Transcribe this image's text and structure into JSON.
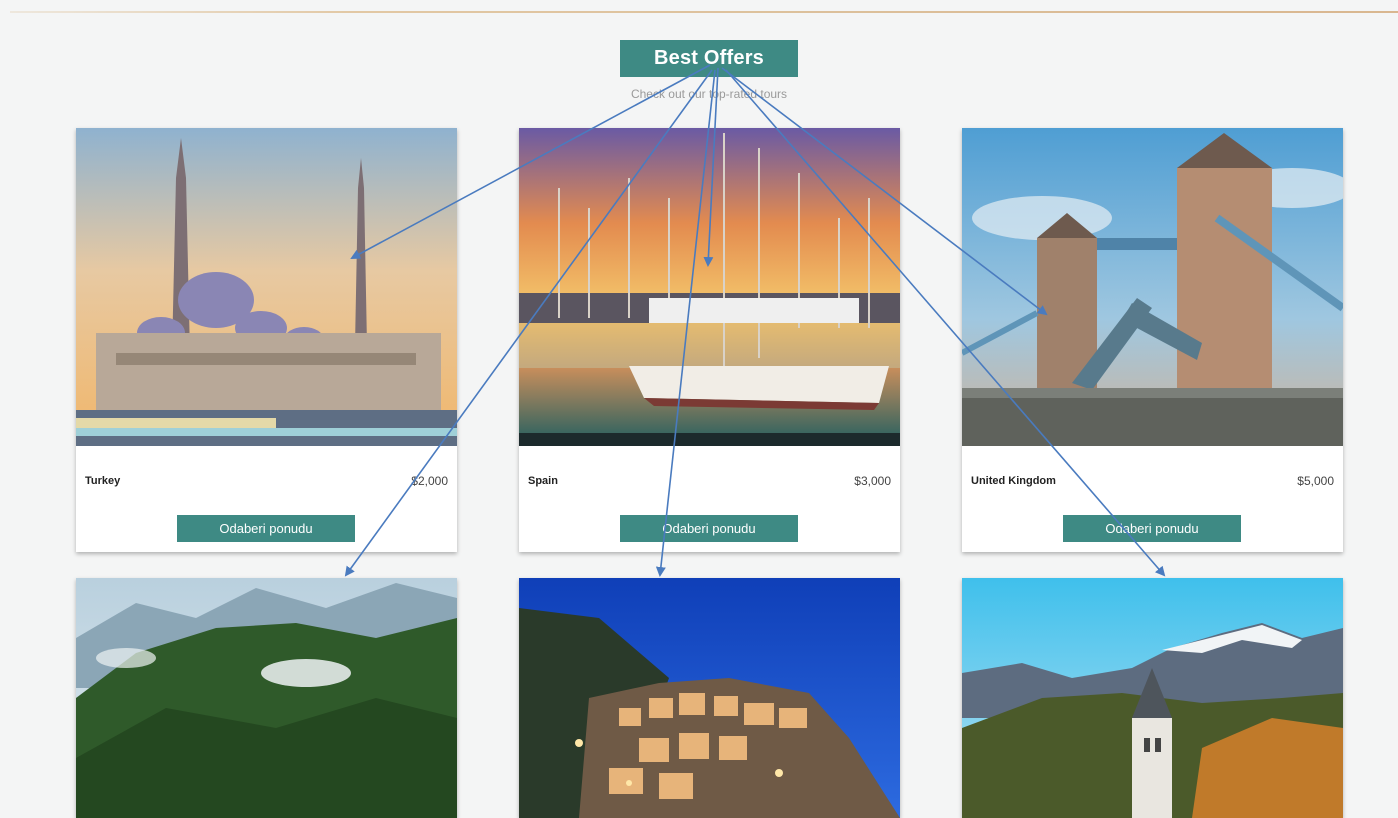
{
  "header": {
    "title": "Best Offers",
    "subtitle": "Check out our top-rated tours"
  },
  "offers": [
    {
      "country": "Turkey",
      "price": "$2,000",
      "button_label": "Odaberi ponudu",
      "image": "istanbul-mosque-photo"
    },
    {
      "country": "Spain",
      "price": "$3,000",
      "button_label": "Odaberi ponudu",
      "image": "marina-sailboats-photo"
    },
    {
      "country": "United Kingdom",
      "price": "$5,000",
      "button_label": "Odaberi ponudu",
      "image": "tower-bridge-photo"
    },
    {
      "image": "forested-mountains-photo"
    },
    {
      "image": "cliffside-village-night-photo"
    },
    {
      "image": "alpine-church-village-photo"
    }
  ],
  "colors": {
    "accent": "#3e8a84",
    "background": "#f4f5f5",
    "annotation_arrow": "#4a7bbf",
    "top_rule": "#dcc09b"
  }
}
